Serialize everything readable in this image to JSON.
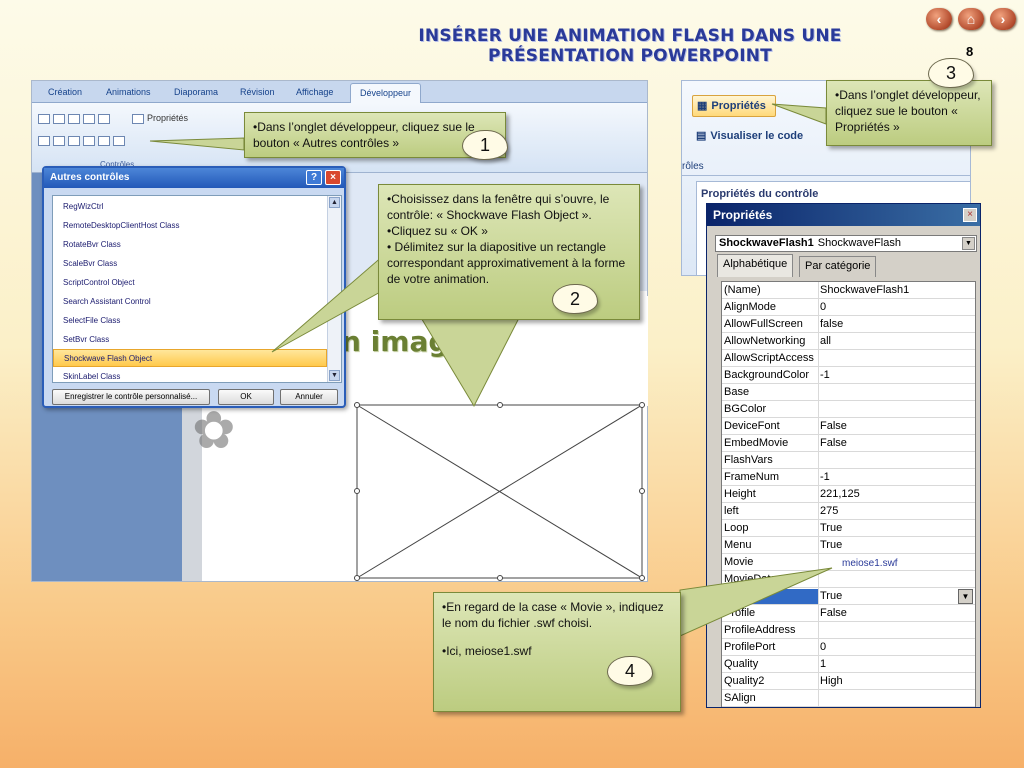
{
  "title": "INSÉRER UNE ANIMATION FLASH DANS UNE PRÉSENTATION POWERPOINT",
  "page_number": "8",
  "nav": {
    "prev": "back-arrow-icon",
    "home": "home-icon",
    "next": "forward-arrow-icon"
  },
  "left_screenshot": {
    "tabs": [
      "Création",
      "Animations",
      "Diaporama",
      "Révision",
      "Affichage",
      "Développeur"
    ],
    "ribbon_properties": "Propriétés",
    "ribbon_group": "Contrôles",
    "slide_text": "en images",
    "dialog": {
      "title": "Autres contrôles",
      "items": [
        "RegWizCtrl",
        "RemoteDesktopClientHost Class",
        "RotateBvr Class",
        "ScaleBvr Class",
        "ScriptControl Object",
        "Search Assistant Control",
        "SelectFile Class",
        "SetBvr Class",
        "Shockwave Flash Object",
        "SkinLabel Class"
      ],
      "selected": "Shockwave Flash Object",
      "register_button": "Enregistrer le contrôle personnalisé...",
      "ok_button": "OK",
      "cancel_button": "Annuler"
    }
  },
  "right_screenshot": {
    "properties_button": "Propriétés",
    "view_code_button": "Visualiser le code",
    "group_label": "rôles",
    "ctl_props_title": "Propriétés du contrôle",
    "window_title": "Propriétés",
    "object_name": "ShockwaveFlash1",
    "object_type": "ShockwaveFlash",
    "tab_alpha": "Alphabétique",
    "tab_category": "Par catégorie",
    "rows": [
      {
        "k": "(Name)",
        "v": "ShockwaveFlash1"
      },
      {
        "k": "AlignMode",
        "v": "0"
      },
      {
        "k": "AllowFullScreen",
        "v": "false"
      },
      {
        "k": "AllowNetworking",
        "v": "all"
      },
      {
        "k": "AllowScriptAccess",
        "v": ""
      },
      {
        "k": "BackgroundColor",
        "v": "-1"
      },
      {
        "k": "Base",
        "v": ""
      },
      {
        "k": "BGColor",
        "v": ""
      },
      {
        "k": "DeviceFont",
        "v": "False"
      },
      {
        "k": "EmbedMovie",
        "v": "False"
      },
      {
        "k": "FlashVars",
        "v": ""
      },
      {
        "k": "FrameNum",
        "v": "-1"
      },
      {
        "k": "Height",
        "v": "221,125"
      },
      {
        "k": "left",
        "v": "275"
      },
      {
        "k": "Loop",
        "v": "True"
      },
      {
        "k": "Menu",
        "v": "True"
      },
      {
        "k": "Movie",
        "v": ""
      },
      {
        "k": "MovieData",
        "v": ""
      },
      {
        "k": "Playing",
        "v": "True"
      },
      {
        "k": "Profile",
        "v": "False"
      },
      {
        "k": "ProfileAddress",
        "v": ""
      },
      {
        "k": "ProfilePort",
        "v": "0"
      },
      {
        "k": "Quality",
        "v": "1"
      },
      {
        "k": "Quality2",
        "v": "High"
      },
      {
        "k": "SAlign",
        "v": ""
      }
    ],
    "movie_overlay": "meiose1.swf"
  },
  "callouts": {
    "c1": {
      "text": "•Dans l’onglet développeur, cliquez sue le bouton  « Autres contrôles »",
      "num": "1"
    },
    "c2": {
      "lines": [
        "•Choisissez dans la fenêtre qui s’ouvre, le contrôle:  « Shockwave Flash Object ».",
        "•Cliquez su « OK »",
        "• Délimitez sur la diapositive un rectangle correspondant approximativement à la forme de votre animation."
      ],
      "num": "2"
    },
    "c3": {
      "text": "•Dans l’onglet développeur, cliquez sue le bouton  « Propriétés »",
      "num": "3"
    },
    "c4": {
      "lines": [
        "•En regard de la case « Movie », indiquez le nom du fichier .swf choisi.",
        "•Ici,   meiose1.swf"
      ],
      "num": "4"
    }
  }
}
